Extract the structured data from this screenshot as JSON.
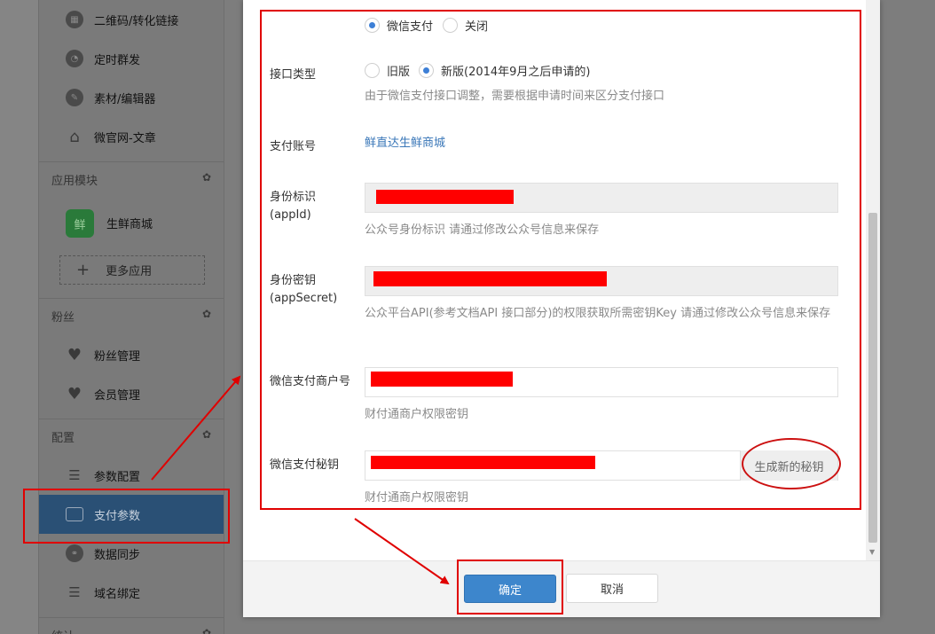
{
  "sidebar": {
    "items_top": [
      {
        "label": "二维码/转化链接",
        "icon": "qrcode-icon"
      },
      {
        "label": "定时群发",
        "icon": "clock-icon"
      },
      {
        "label": "素材/编辑器",
        "icon": "pencil-icon"
      },
      {
        "label": "微官网-文章",
        "icon": "home-icon"
      }
    ],
    "section_apps": "应用模块",
    "app_label": "生鲜商城",
    "app_glyph": "鲜",
    "more_apps": "更多应用",
    "section_fans": "粉丝",
    "fans_items": [
      {
        "label": "粉丝管理",
        "icon": "heart-icon"
      },
      {
        "label": "会员管理",
        "icon": "heart-icon"
      }
    ],
    "section_config": "配置",
    "config_items": [
      {
        "label": "参数配置",
        "icon": "list-icon"
      },
      {
        "label": "支付参数",
        "icon": "wallet-icon",
        "active": true
      },
      {
        "label": "数据同步",
        "icon": "link-icon"
      },
      {
        "label": "域名绑定",
        "icon": "list-icon"
      }
    ],
    "section_stats": "统计"
  },
  "form": {
    "payment_radio": {
      "option_on": "微信支付",
      "option_off": "关闭",
      "selected": "微信支付"
    },
    "interface_type": {
      "label": "接口类型",
      "option_old": "旧版",
      "option_new": "新版(2014年9月之后申请的)",
      "selected": "新版(2014年9月之后申请的)",
      "help": "由于微信支付接口调整，需要根据申请时间来区分支付接口"
    },
    "pay_account": {
      "label": "支付账号",
      "value": "鲜直达生鲜商城"
    },
    "app_id": {
      "label_line1": "身份标识",
      "label_line2": "(appId)",
      "help": "公众号身份标识 请通过修改公众号信息来保存"
    },
    "app_secret": {
      "label_line1": "身份密钥",
      "label_line2": "(appSecret)",
      "help": "公众平台API(参考文档API 接口部分)的权限获取所需密钥Key 请通过修改公众号信息来保存"
    },
    "merchant_id": {
      "label": "微信支付商户号",
      "help": "财付通商户权限密钥"
    },
    "pay_secret": {
      "label": "微信支付秘钥",
      "help": "财付通商户权限密钥",
      "generate_button": "生成新的秘钥"
    }
  },
  "footer": {
    "confirm": "确定",
    "cancel": "取消"
  },
  "colors": {
    "primary": "#3d86cc",
    "annotation": "#e00000",
    "link": "#3a77b8"
  }
}
